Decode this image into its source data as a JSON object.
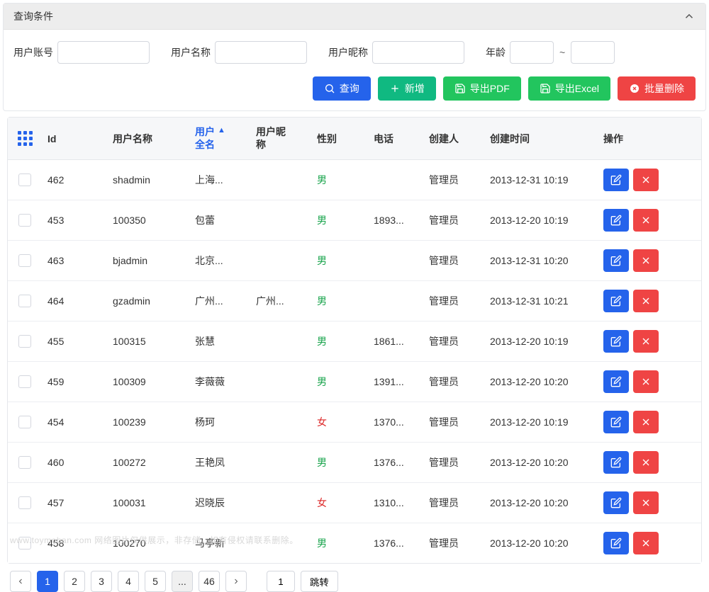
{
  "panel": {
    "title": "查询条件"
  },
  "filters": {
    "account_label": "用户账号",
    "name_label": "用户名称",
    "nickname_label": "用户昵称",
    "age_label": "年龄",
    "tilde": "~"
  },
  "actions": {
    "query": "查询",
    "add": "新增",
    "export_pdf": "导出PDF",
    "export_excel": "导出Excel",
    "bulk_delete": "批量删除"
  },
  "columns": {
    "id": "Id",
    "username": "用户名称",
    "fullname_l1": "用户",
    "fullname_l2": "全名",
    "nickname_l1": "用户昵",
    "nickname_l2": "称",
    "gender": "性别",
    "phone": "电话",
    "creator": "创建人",
    "created_at": "创建时间",
    "ops": "操作"
  },
  "gender_labels": {
    "m": "男",
    "f": "女"
  },
  "rows": [
    {
      "id": "462",
      "username": "shadmin",
      "fullname": "上海...",
      "nickname": "",
      "gender": "m",
      "phone": "",
      "creator": "管理员",
      "created_at": "2013-12-31 10:19"
    },
    {
      "id": "453",
      "username": "100350",
      "fullname": "包蕾",
      "nickname": "",
      "gender": "m",
      "phone": "1893...",
      "creator": "管理员",
      "created_at": "2013-12-20 10:19"
    },
    {
      "id": "463",
      "username": "bjadmin",
      "fullname": "北京...",
      "nickname": "",
      "gender": "m",
      "phone": "",
      "creator": "管理员",
      "created_at": "2013-12-31 10:20"
    },
    {
      "id": "464",
      "username": "gzadmin",
      "fullname": "广州...",
      "nickname": "广州...",
      "gender": "m",
      "phone": "",
      "creator": "管理员",
      "created_at": "2013-12-31 10:21"
    },
    {
      "id": "455",
      "username": "100315",
      "fullname": "张慧",
      "nickname": "",
      "gender": "m",
      "phone": "1861...",
      "creator": "管理员",
      "created_at": "2013-12-20 10:19"
    },
    {
      "id": "459",
      "username": "100309",
      "fullname": "李薇薇",
      "nickname": "",
      "gender": "m",
      "phone": "1391...",
      "creator": "管理员",
      "created_at": "2013-12-20 10:20"
    },
    {
      "id": "454",
      "username": "100239",
      "fullname": "杨珂",
      "nickname": "",
      "gender": "f",
      "phone": "1370...",
      "creator": "管理员",
      "created_at": "2013-12-20 10:19"
    },
    {
      "id": "460",
      "username": "100272",
      "fullname": "王艳凤",
      "nickname": "",
      "gender": "m",
      "phone": "1376...",
      "creator": "管理员",
      "created_at": "2013-12-20 10:20"
    },
    {
      "id": "457",
      "username": "100031",
      "fullname": "迟晓辰",
      "nickname": "",
      "gender": "f",
      "phone": "1310...",
      "creator": "管理员",
      "created_at": "2013-12-20 10:20"
    },
    {
      "id": "458",
      "username": "100270",
      "fullname": "马亭新",
      "nickname": "",
      "gender": "m",
      "phone": "1376...",
      "creator": "管理员",
      "created_at": "2013-12-20 10:20"
    }
  ],
  "pager": {
    "pages": [
      "1",
      "2",
      "3",
      "4",
      "5",
      "...",
      "46"
    ],
    "active": "1",
    "goto_value": "1",
    "jump": "跳转"
  },
  "watermark": "www.toymoban.com  网络图片仅供展示，非存储，如有侵权请联系删除。"
}
